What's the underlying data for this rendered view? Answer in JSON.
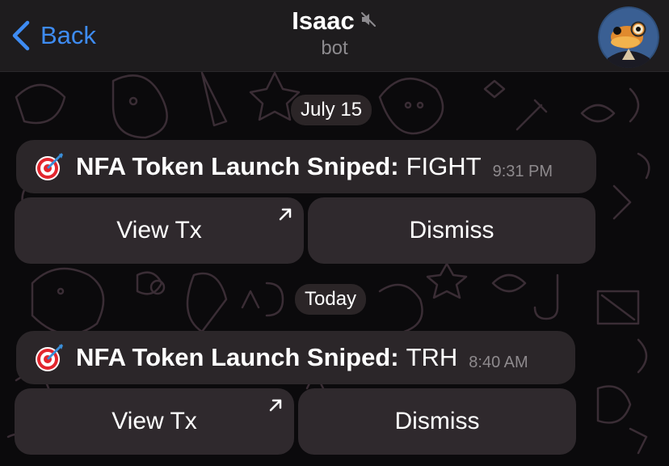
{
  "header": {
    "back_label": "Back",
    "title": "Isaac",
    "subtitle": "bot",
    "muted": true
  },
  "messages": [
    {
      "date": "July 15",
      "emoji": "dart-target-icon",
      "title": "NFA Token Launch Sniped:",
      "token": "FIGHT",
      "time": "9:31 PM",
      "buttons": [
        "View Tx",
        "Dismiss"
      ]
    },
    {
      "date": "Today",
      "emoji": "dart-target-icon",
      "title": "NFA Token Launch Sniped:",
      "token": "TRH",
      "time": "8:40 AM",
      "buttons": [
        "View Tx",
        "Dismiss"
      ]
    }
  ],
  "colors": {
    "accent": "#3e8cf3",
    "bubble": "#2b2629",
    "background": "#0b0a0c"
  }
}
